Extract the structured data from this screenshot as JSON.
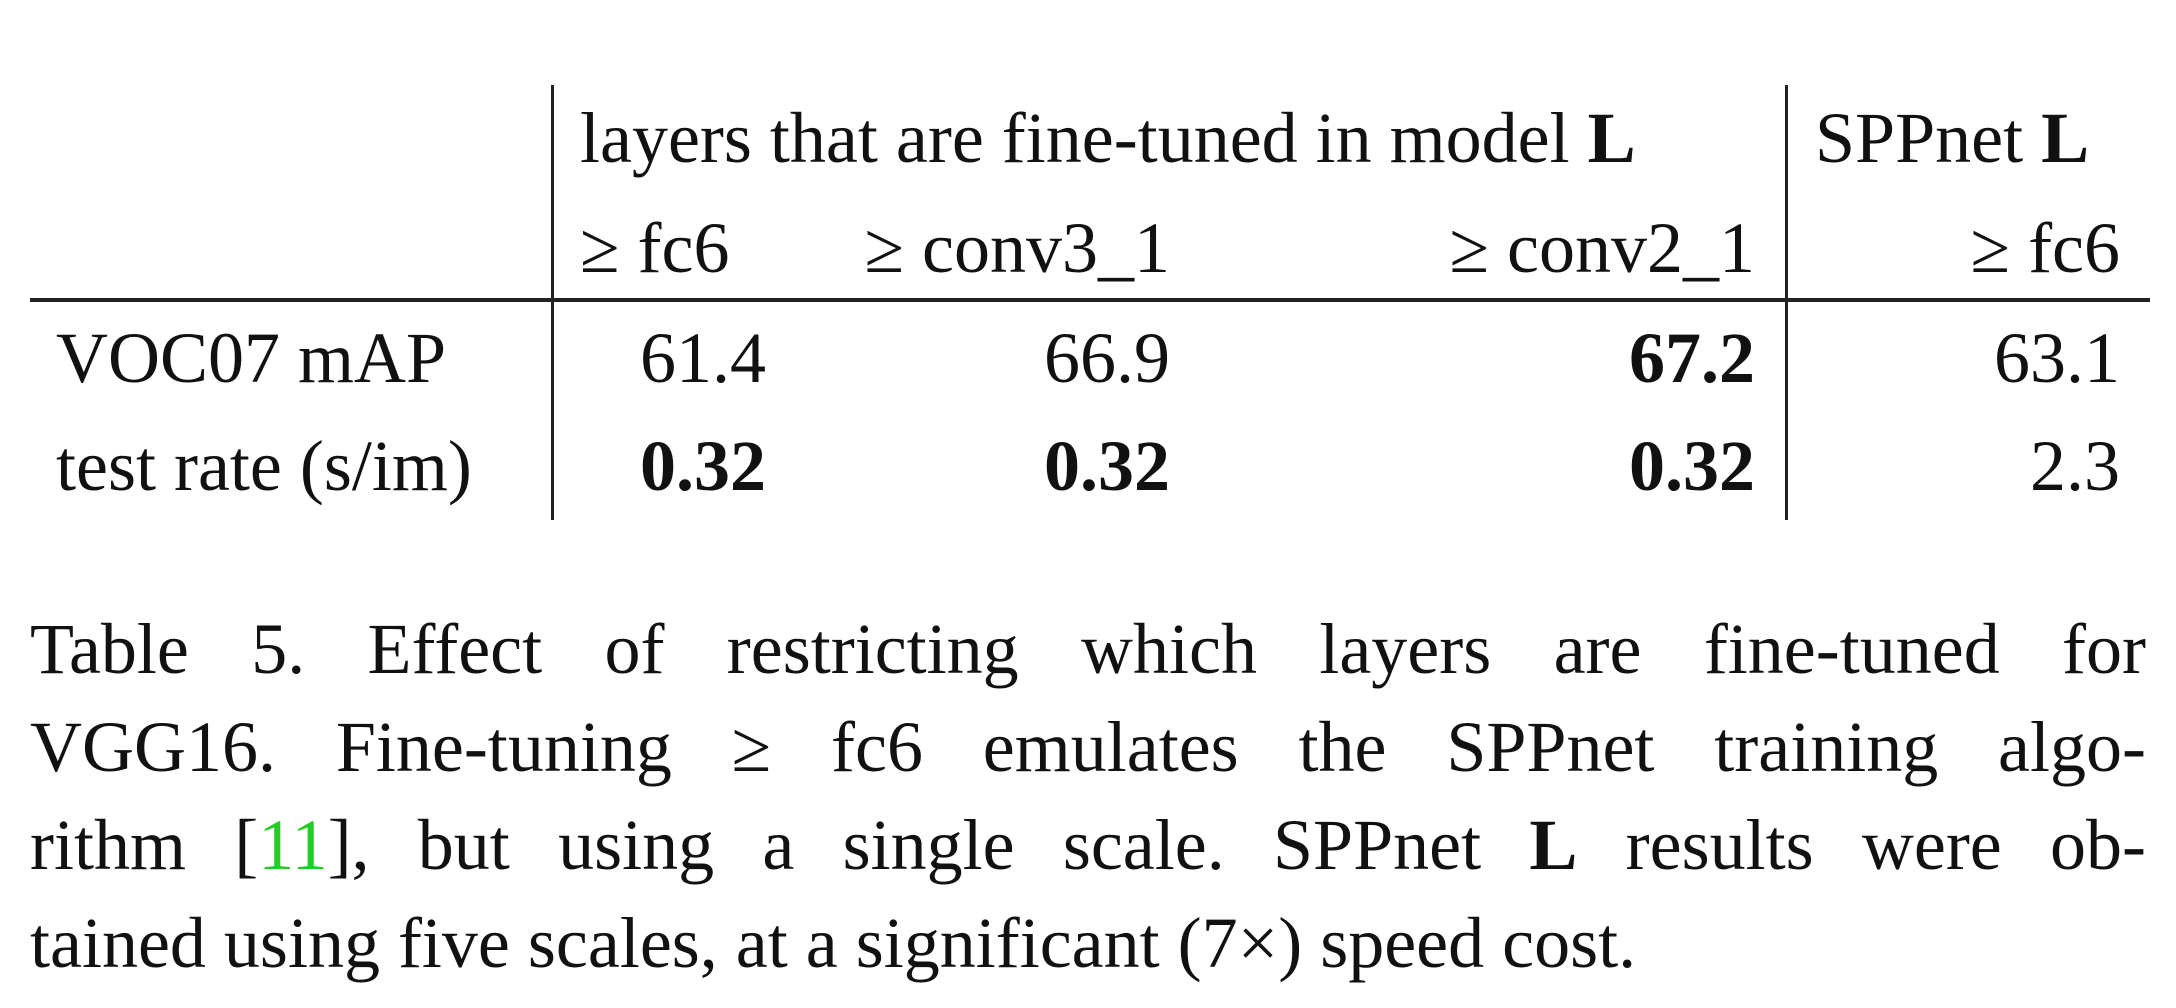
{
  "table": {
    "header_group_1": {
      "text": "layers that are fine-tuned in model ",
      "bold_suffix": "L"
    },
    "header_group_2": {
      "text": "SPPnet ",
      "bold_suffix": "L"
    },
    "subheaders": [
      {
        "id": "fc6",
        "text": "≥ fc6"
      },
      {
        "id": "conv3_1",
        "text": "≥ conv3_1"
      },
      {
        "id": "conv2_1",
        "text": "≥ conv2_1"
      },
      {
        "id": "spp_fc6",
        "text": "≥ fc6"
      }
    ],
    "rows": [
      {
        "label": "VOC07 mAP",
        "cells": [
          {
            "value": "61.4",
            "bold": false
          },
          {
            "value": "66.9",
            "bold": false
          },
          {
            "value": "67.2",
            "bold": true
          },
          {
            "value": "63.1",
            "bold": false
          }
        ]
      },
      {
        "label": "test rate (s/im)",
        "cells": [
          {
            "value": "0.32",
            "bold": true
          },
          {
            "value": "0.32",
            "bold": true
          },
          {
            "value": "0.32",
            "bold": true
          },
          {
            "value": "2.3",
            "bold": false
          }
        ]
      }
    ]
  },
  "caption": {
    "line1": "Table 5. Effect of restricting which layers are fine-tuned for",
    "line2": "VGG16.  Fine-tuning ≥ fc6 emulates the SPPnet training algo-",
    "line3_before_ref": "rithm [",
    "line3_ref": "11",
    "line3_after_ref": "], but using a single scale.  SPPnet ",
    "line3_bold": "L",
    "line3_end": " results were ob-",
    "line4": "tained using five scales, at a significant (7×) speed cost."
  }
}
